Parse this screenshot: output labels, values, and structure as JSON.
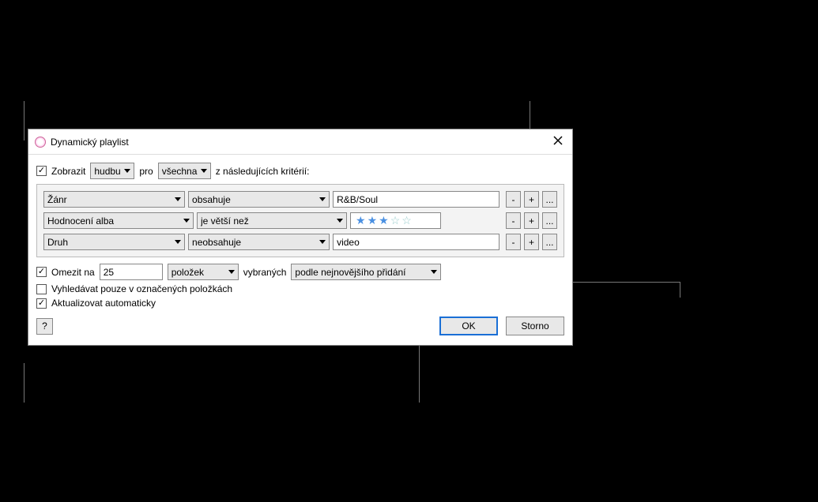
{
  "title": "Dynamický playlist",
  "header": {
    "show_label": "Zobrazit",
    "media": "hudbu",
    "for_label": "pro",
    "match": "všechna",
    "following_label": "z následujících kritérií:"
  },
  "rules": [
    {
      "field": "Žánr",
      "op": "obsahuje",
      "value": "R&B/Soul",
      "type": "text"
    },
    {
      "field": "Hodnocení alba",
      "op": "je větší než",
      "value": 3,
      "type": "stars"
    },
    {
      "field": "Druh",
      "op": "neobsahuje",
      "value": "video",
      "type": "text"
    }
  ],
  "limit": {
    "label": "Omezit na",
    "value": "25",
    "unit": "položek",
    "selected_label": "vybraných",
    "by": "podle nejnovějšího přidání"
  },
  "only_checked_label": "Vyhledávat pouze v označených položkách",
  "live_update_label": "Aktualizovat automaticky",
  "buttons": {
    "help": "?",
    "ok": "OK",
    "cancel": "Storno",
    "minus": "-",
    "plus": "+",
    "more": "..."
  }
}
